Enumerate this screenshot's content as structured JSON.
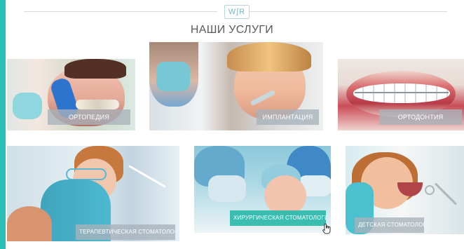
{
  "header": {
    "logo": "W∫R",
    "title": "НАШИ УСЛУГИ"
  },
  "services": [
    {
      "label": "ОРТОПЕДИЯ",
      "active": false
    },
    {
      "label": "ИМПЛАНТАЦИЯ",
      "active": false
    },
    {
      "label": "ОРТОДОНТИЯ",
      "active": false
    },
    {
      "label": "ТЕРАПЕВТИЧЕСКАЯ СТОМАТОЛОГИЯ",
      "active": false
    },
    {
      "label": "ХИРУРГИЧЕСКАЯ СТОМАТОЛОГИЯ",
      "active": true
    },
    {
      "label": "ДЕТСКАЯ СТОМАТОЛОГИЯ",
      "active": false
    }
  ],
  "colors": {
    "accent": "#2abfb4",
    "label_background": "#a8b2bb",
    "active_label_background": "#2db9aa",
    "title": "#5b5b5b"
  },
  "icons": {
    "logo": "wdr-logo-icon",
    "cursor": "hand-pointer-icon"
  }
}
